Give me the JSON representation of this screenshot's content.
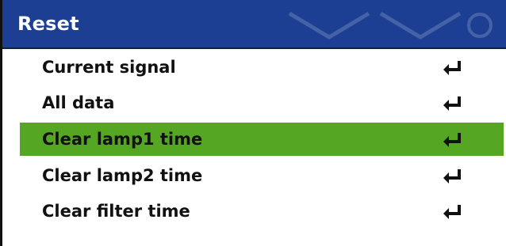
{
  "menu": {
    "title": "Reset",
    "items": [
      {
        "label": "Current signal",
        "icon": "enter-return-icon",
        "selected": false
      },
      {
        "label": "All data",
        "icon": "enter-return-icon",
        "selected": false
      },
      {
        "label": "Clear lamp1 time",
        "icon": "enter-return-icon",
        "selected": true
      },
      {
        "label": "Clear lamp2 time",
        "icon": "enter-return-icon",
        "selected": false
      },
      {
        "label": "Clear filter time",
        "icon": "enter-return-icon",
        "selected": false
      }
    ]
  },
  "colors": {
    "header": "#1c3f94",
    "selection": "#55a623",
    "text": "#111111",
    "background": "#ffffff"
  }
}
